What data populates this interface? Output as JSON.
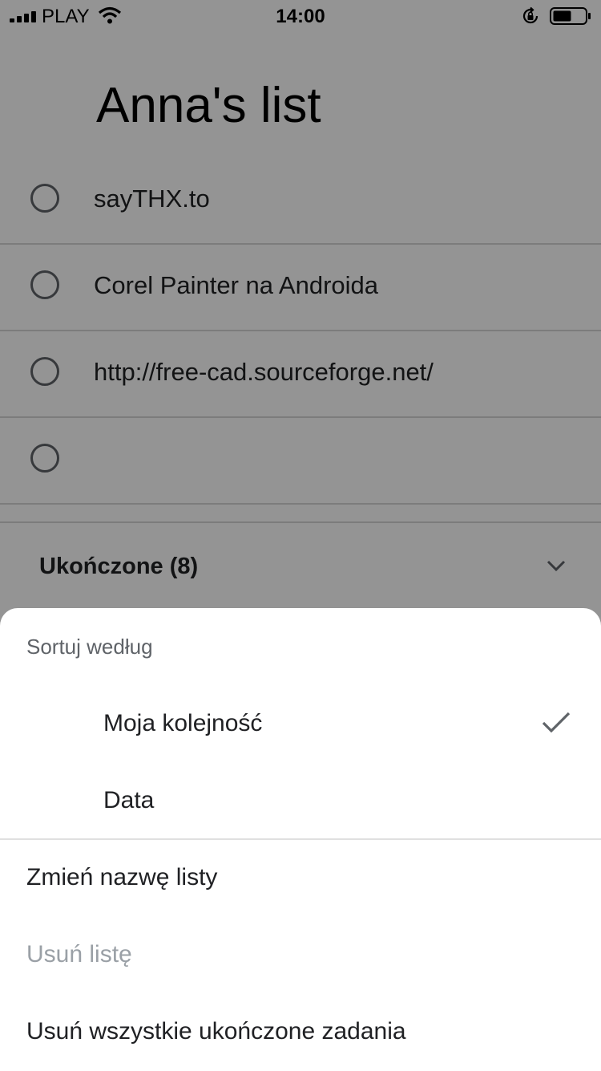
{
  "status_bar": {
    "carrier": "PLAY",
    "time": "14:00"
  },
  "list": {
    "title": "Anna's list",
    "tasks": [
      {
        "text": "sayTHX.to"
      },
      {
        "text": "Corel Painter na Androida"
      },
      {
        "text": "http://free-cad.sourceforge.net/"
      },
      {
        "text": ""
      }
    ],
    "completed_label": "Ukończone (8)"
  },
  "sheet": {
    "sort_heading": "Sortuj według",
    "sort_options": [
      {
        "label": "Moja kolejność",
        "selected": true
      },
      {
        "label": "Data",
        "selected": false
      }
    ],
    "actions": [
      {
        "label": "Zmień nazwę listy",
        "enabled": true
      },
      {
        "label": "Usuń listę",
        "enabled": false
      },
      {
        "label": "Usuń wszystkie ukończone zadania",
        "enabled": true
      }
    ]
  },
  "icons": {
    "signal": "signal-bars-icon",
    "wifi": "wifi-icon",
    "rotation_lock": "rotation-lock-icon",
    "battery": "battery-icon",
    "task_checkbox": "circle-checkbox-icon",
    "expand": "chevron-down-icon",
    "selected": "checkmark-icon"
  },
  "colors": {
    "scrim": "#000000",
    "scrim_opacity": 0.42,
    "primary_text": "#202124",
    "secondary_text": "#5f6368",
    "disabled_text": "#9aa0a6"
  }
}
